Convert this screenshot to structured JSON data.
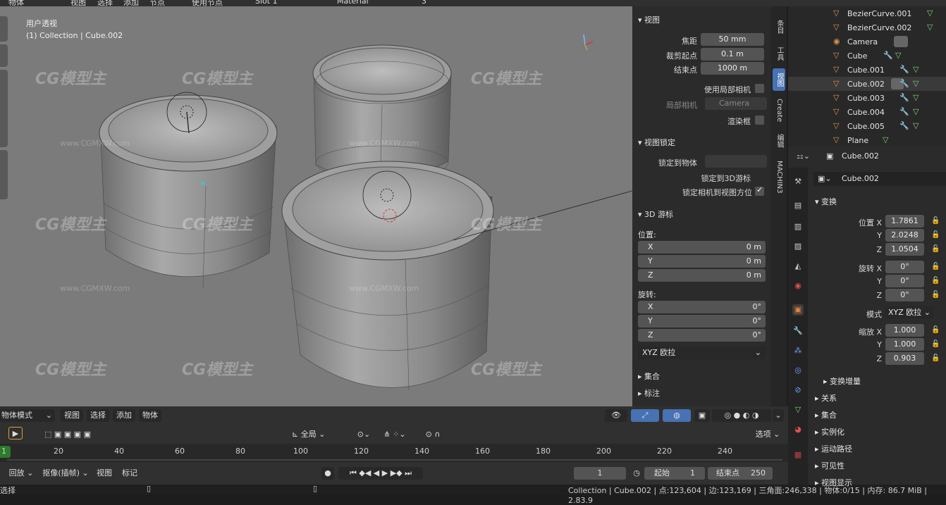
{
  "top_header": {
    "mode": "物体",
    "menus": [
      "视图",
      "选择",
      "添加",
      "节点"
    ],
    "use_nodes": "使用节点",
    "slot": "Slot 1",
    "material": "Material",
    "users": "3"
  },
  "viewport": {
    "view_name": "用户透视",
    "collection_path": "(1) Collection | Cube.002",
    "watermark_text": "CG模型主",
    "watermark_url": "www.CGMXW.com"
  },
  "npanel": {
    "view_section": "视图",
    "focal_label": "焦距",
    "focal_value": "50 mm",
    "clip_start_label": "裁剪起点",
    "clip_start_value": "0.1 m",
    "clip_end_label": "结束点",
    "clip_end_value": "1000 m",
    "use_local_camera": "使用局部相机",
    "local_camera_label": "局部相机",
    "local_camera_value": "Camera",
    "render_border": "渲染框",
    "view_lock_section": "视图锁定",
    "lock_to_object": "锁定到物体",
    "lock_to_cursor": "锁定到3D游标",
    "lock_camera_to_view": "锁定相机到视图方位",
    "cursor_section": "3D 游标",
    "location_label": "位置:",
    "loc_x_label": "X",
    "loc_x": "0 m",
    "loc_y_label": "Y",
    "loc_y": "0 m",
    "loc_z_label": "Z",
    "loc_z": "0 m",
    "rotation_label": "旋转:",
    "rot_x_label": "X",
    "rot_x": "0°",
    "rot_y_label": "Y",
    "rot_y": "0°",
    "rot_z_label": "Z",
    "rot_z": "0°",
    "rot_mode": "XYZ 欧拉",
    "collections_section": "集合",
    "annotations_section": "标注"
  },
  "ntabs": [
    "条目",
    "工具",
    "视图",
    "Create",
    "编辑",
    "MACHIN3"
  ],
  "vp_header": {
    "mode": "物体模式",
    "view": "视图",
    "select": "选择",
    "add": "添加",
    "object": "物体",
    "orientation": "全局",
    "options": "选项"
  },
  "timeline": {
    "ticks": [
      "1",
      "20",
      "40",
      "60",
      "80",
      "100",
      "120",
      "140",
      "160",
      "180",
      "200",
      "220",
      "240"
    ],
    "playback": "回放",
    "keying": "抠像(插帧)",
    "view": "视图",
    "marker": "标记",
    "current_frame": "1",
    "start_label": "起始",
    "start_value": "1",
    "end_label": "结束点",
    "end_value": "250"
  },
  "statusbar": {
    "left": "选择",
    "stats": "Collection | Cube.002 | 点:123,604 | 边:123,169 | 三角面:246,338 | 物体:0/15 | 内存: 86.7 MiB | 2.83.9"
  },
  "outliner": {
    "items": [
      {
        "name": "BezierCurve.001"
      },
      {
        "name": "BezierCurve.002"
      },
      {
        "name": "Camera"
      },
      {
        "name": "Cube"
      },
      {
        "name": "Cube.001"
      },
      {
        "name": "Cube.002"
      },
      {
        "name": "Cube.003"
      },
      {
        "name": "Cube.004"
      },
      {
        "name": "Cube.005"
      },
      {
        "name": "Plane"
      }
    ]
  },
  "properties": {
    "header_object": "Cube.002",
    "object_name": "Cube.002",
    "transform_section": "变换",
    "location_label": "位置 X",
    "loc_x": "1.7861",
    "loc_y_label": "Y",
    "loc_y": "2.0248",
    "loc_z_label": "Z",
    "loc_z": "1.0504",
    "rotation_label": "旋转 X",
    "rot_x": "0°",
    "rot_y_label": "Y",
    "rot_y": "0°",
    "rot_z_label": "Z",
    "rot_z": "0°",
    "mode_label": "模式",
    "mode_value": "XYZ 欧拉",
    "scale_label": "缩放 X",
    "scale_x": "1.000",
    "scale_y_label": "Y",
    "scale_y": "1.000",
    "scale_z_label": "Z",
    "scale_z": "0.903",
    "delta_transform": "变换增量",
    "relations": "关系",
    "collections": "集合",
    "instancing": "实例化",
    "motion_paths": "运动路径",
    "visibility": "可见性",
    "viewport_display": "视图显示"
  },
  "colors": {
    "accent": "#4772b3",
    "viewport_bg": "#7b7b7b",
    "panel_bg": "#2b2b2b",
    "field_bg": "#545454"
  }
}
